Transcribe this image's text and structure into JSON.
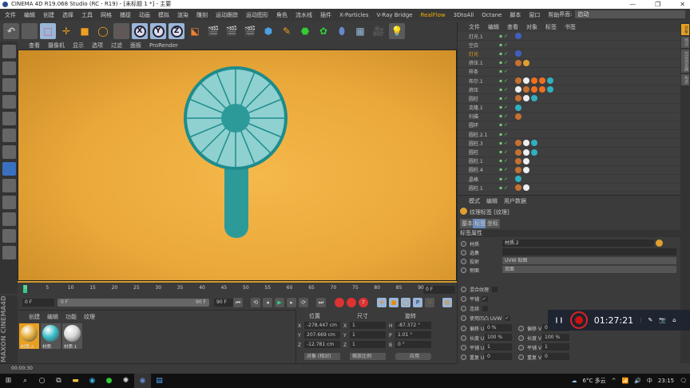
{
  "title": "CINEMA 4D R19.068 Studio (RC - R19) - [未标题 1 *] - 主要",
  "window_controls": [
    "—",
    "❐",
    "✕"
  ],
  "menu": [
    "文件",
    "编辑",
    "创建",
    "选择",
    "工具",
    "网格",
    "捕捉",
    "动画",
    "模拟",
    "渲染",
    "雕刻",
    "运动跟踪",
    "运动图形",
    "角色",
    "流水线",
    "插件",
    "X-Particles",
    "V-Ray Bridge",
    "RealFlow",
    "3DtoAll",
    "Octane",
    "脚本",
    "窗口",
    "帮助"
  ],
  "interface": {
    "label": "界面:",
    "value": "启动"
  },
  "toolbar_axes": [
    "X",
    "Y",
    "Z"
  ],
  "viewport_menu": [
    "查看",
    "摄像机",
    "显示",
    "选项",
    "过滤",
    "面板",
    "ProRender"
  ],
  "timeline": {
    "ticks": [
      "0",
      "5",
      "10",
      "15",
      "20",
      "25",
      "30",
      "35",
      "40",
      "45",
      "50",
      "55",
      "60",
      "65",
      "70",
      "75",
      "80",
      "85",
      "90"
    ],
    "current": "0 F",
    "start": "0 F",
    "range_start": "0 F",
    "range_end": "90 F",
    "end": "90 F"
  },
  "materials": {
    "menu": [
      "创建",
      "编辑",
      "功能",
      "纹理"
    ],
    "items": [
      {
        "name": "材质.2",
        "color": "#e6b040"
      },
      {
        "name": "材质",
        "color": "#3cc0cc"
      },
      {
        "name": "材质.1",
        "color": "#d8d8d8"
      }
    ]
  },
  "coords": {
    "headers": [
      "位置",
      "尺寸",
      "旋转"
    ],
    "rows": [
      [
        "X",
        "-278.447 cm",
        "X",
        "1",
        "H",
        "-87.372 °"
      ],
      [
        "Y",
        "207.669 cm",
        "Y",
        "1",
        "P",
        "1.01 °"
      ],
      [
        "Z",
        "-12.781 cm",
        "Z",
        "1",
        "B",
        "0 °"
      ]
    ],
    "mode": "对象 (相对)",
    "scale_mode": "缩放比例",
    "apply": "应用"
  },
  "brand": "MAXON CINEMA 4D",
  "status": "00:00:30",
  "objects": {
    "menu": [
      "文件",
      "编辑",
      "查看",
      "对象",
      "标签",
      "书签"
    ],
    "items": [
      {
        "name": "灯光.1",
        "tags": [
          "#4060c0"
        ]
      },
      {
        "name": "空白",
        "tags": []
      },
      {
        "name": "灯光",
        "tags": [
          "#4060c0"
        ],
        "active": true
      },
      {
        "name": "挤压.1",
        "tags": [
          "#c87030",
          "#e0a030"
        ]
      },
      {
        "name": "样条",
        "tags": []
      },
      {
        "name": "布尔.1",
        "tags": [
          "#c87030",
          "#eee",
          "#f07020",
          "#f07020",
          "#30b0c0"
        ]
      },
      {
        "name": "挤压",
        "tags": [
          "#eee",
          "#c87030",
          "#f07020",
          "#f07020",
          "#30b0c0"
        ]
      },
      {
        "name": "圆柱",
        "tags": [
          "#c87030",
          "#eee",
          "#30b0c0"
        ]
      },
      {
        "name": "克隆.1",
        "tags": [
          "#30b0c0"
        ]
      },
      {
        "name": "扫描",
        "tags": [
          "#c87030"
        ]
      },
      {
        "name": "圆环",
        "tags": []
      },
      {
        "name": "圆柱.2.1",
        "tags": []
      },
      {
        "name": "圆柱.3",
        "tags": [
          "#c87030",
          "#eee",
          "#30b0c0"
        ]
      },
      {
        "name": "圆柱",
        "tags": [
          "#c87030",
          "#eee",
          "#30b0c0"
        ]
      },
      {
        "name": "圆柱.1",
        "tags": [
          "#c87030",
          "#eee"
        ]
      },
      {
        "name": "圆柱.4",
        "tags": [
          "#c87030",
          "#eee"
        ]
      },
      {
        "name": "晶格",
        "tags": [
          "#30b0c0"
        ]
      },
      {
        "name": "圆柱.1",
        "tags": [
          "#c87030",
          "#eee"
        ]
      }
    ]
  },
  "side_tabs": [
    "对象",
    "场次",
    "内容浏览器",
    "构造"
  ],
  "attributes": {
    "menu": [
      "模式",
      "编辑",
      "用户数据"
    ],
    "title": "纹理标签 [纹理]",
    "tabs": [
      "基本",
      "标签",
      "坐标"
    ],
    "section": "标签属性",
    "material_label": "材质",
    "material": "材质.2",
    "selection_label": "选集",
    "projection_label": "投射",
    "projection": "UVW 贴图",
    "side_label": "侧面",
    "side": "双面",
    "mix_label": "混合纹理",
    "tile_label": "平铺",
    "seamless_label": "连续",
    "use_uvw_label": "使用凹凸 UVW",
    "pairs": [
      [
        "偏移 U",
        "0 %",
        "偏移 V",
        "0 %"
      ],
      [
        "长度 U",
        "100 %",
        "长度 V",
        "100 %"
      ],
      [
        "平铺 U",
        "1",
        "平铺 V",
        "1"
      ],
      [
        "重复 U",
        "0",
        "重复 V",
        "0"
      ]
    ]
  },
  "recorder": {
    "time": "01:27:21"
  },
  "tray": {
    "weather": "6°C 多云",
    "ime": "中",
    "clock": "23:15"
  }
}
